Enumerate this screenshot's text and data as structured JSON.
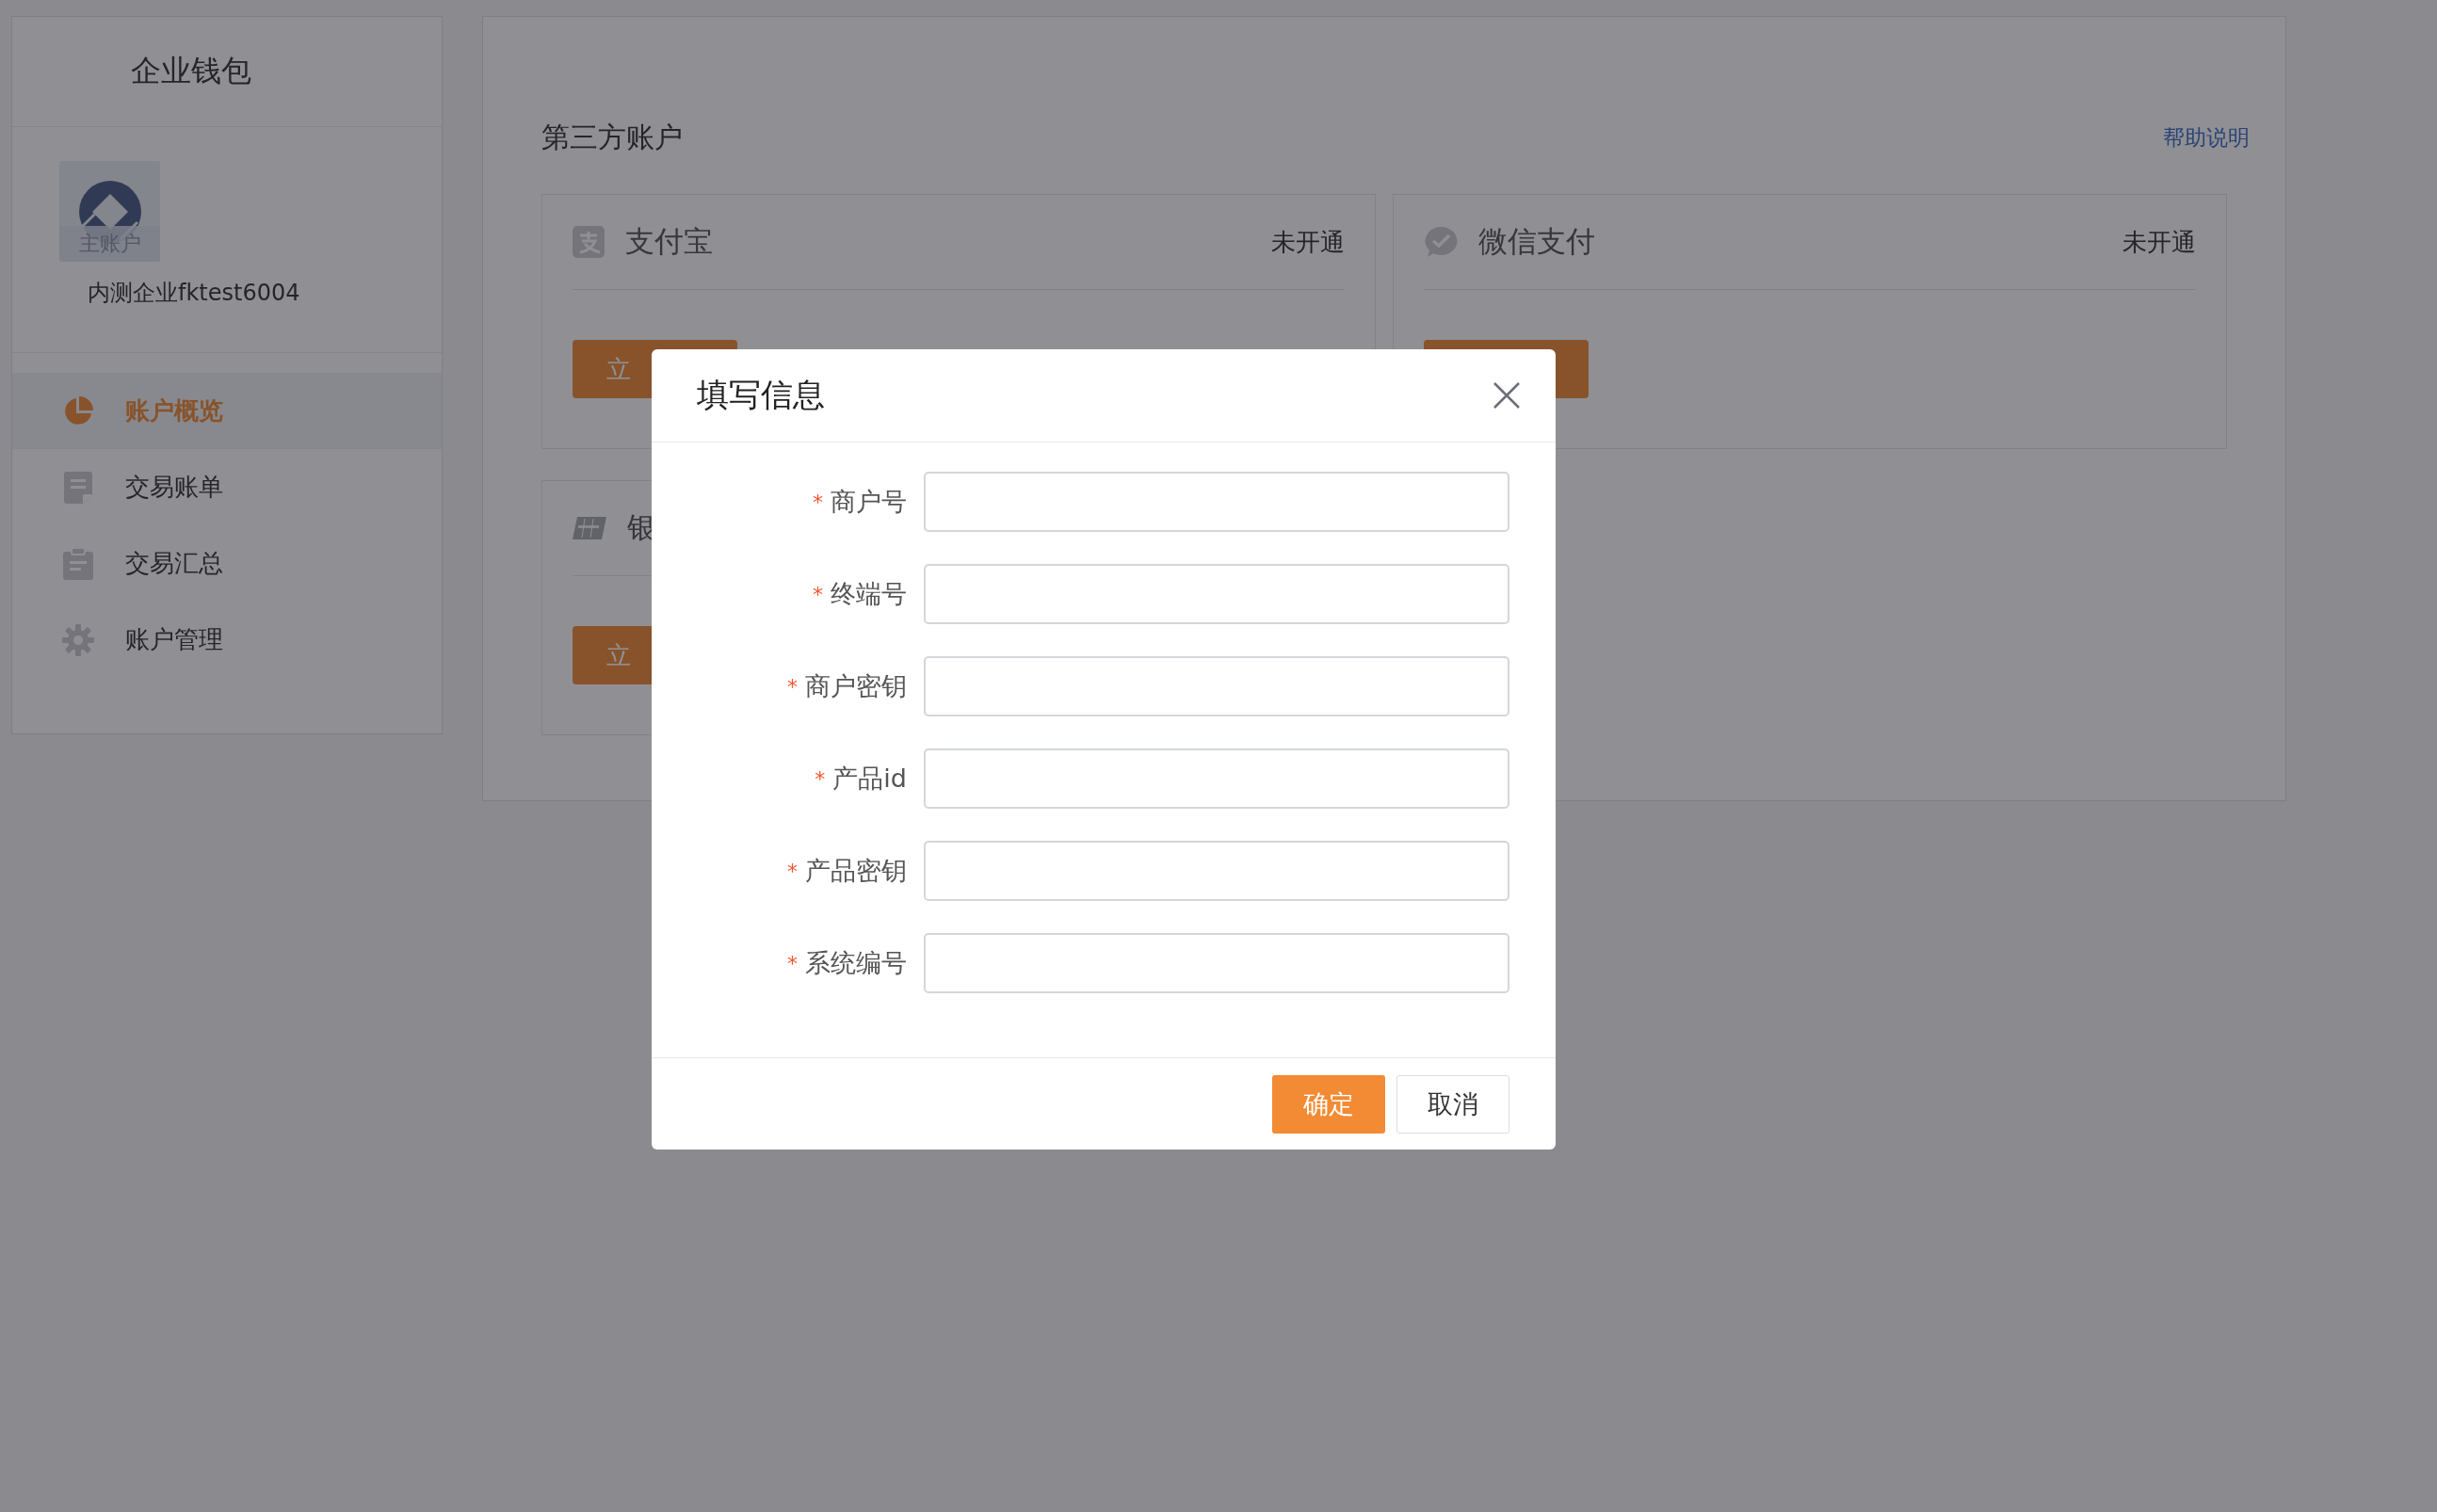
{
  "sidebar": {
    "title": "企业钱包",
    "avatar_label": "主账户",
    "company": "内测企业fktest6004",
    "menu": [
      {
        "label": "账户概览",
        "kind": "pie",
        "selected": true
      },
      {
        "label": "交易账单",
        "kind": "document",
        "selected": false
      },
      {
        "label": "交易汇总",
        "kind": "clipboard",
        "selected": false
      },
      {
        "label": "账户管理",
        "kind": "gear",
        "selected": false
      }
    ]
  },
  "main": {
    "title": "第三方账户",
    "help_link": "帮助说明",
    "cards": [
      {
        "kind": "alipay",
        "name": "支付宝",
        "status": "未开通",
        "button": "立"
      },
      {
        "kind": "wechat",
        "name": "微信支付",
        "status": "未开通"
      },
      {
        "kind": "unionpay",
        "name": "银",
        "button": "立"
      }
    ]
  },
  "dialog": {
    "title": "填写信息",
    "fields": [
      {
        "label": "商户号",
        "required_mark": "*"
      },
      {
        "label": "终端号",
        "required_mark": "*"
      },
      {
        "label": "商户密钥",
        "required_mark": "*"
      },
      {
        "label": "产品id",
        "required_mark": "*"
      },
      {
        "label": "产品密钥",
        "required_mark": "*"
      },
      {
        "label": "系统编号",
        "required_mark": "*"
      }
    ],
    "buttons": [
      {
        "label": "确定",
        "kind": "primary"
      },
      {
        "label": "取消",
        "kind": "default"
      }
    ]
  }
}
